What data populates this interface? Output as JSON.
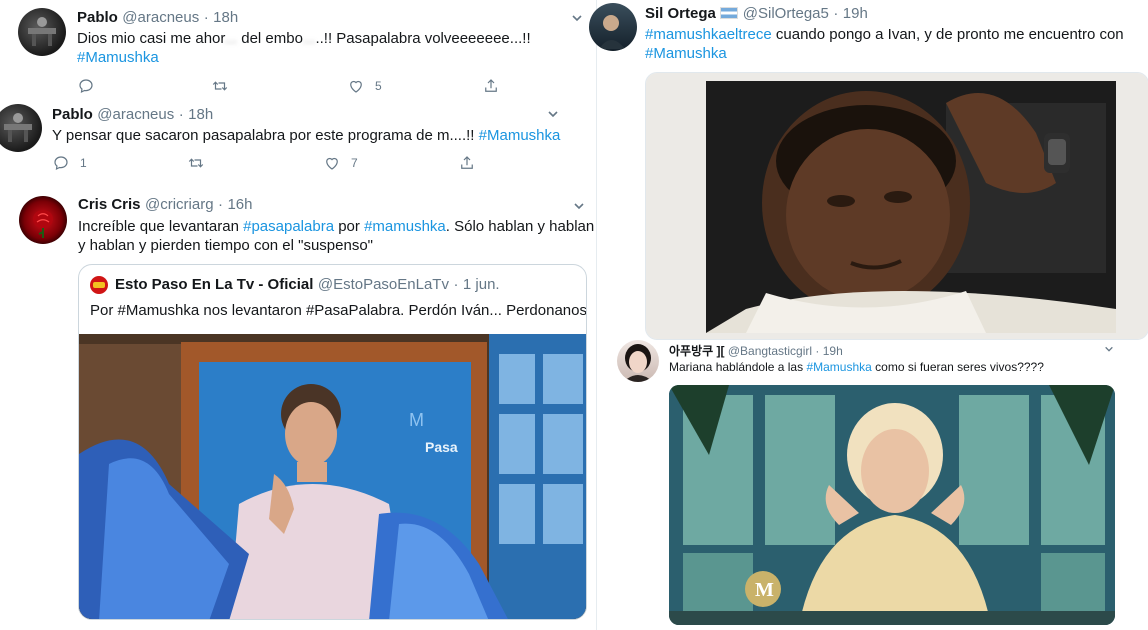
{
  "tweets": [
    {
      "name": "Pablo",
      "handle": "@aracneus",
      "time": "18h",
      "text_pre": "Dios mio casi me ahor",
      "text_blur": "...",
      "text_mid": " del embo",
      "text_blur2": "...",
      "text_post": "..!! Pasapalabra volveeeeeee...!!",
      "hashtag": "#Mamushka",
      "reply_count": "",
      "retweet_count": "",
      "like_count": "5"
    },
    {
      "name": "Pablo",
      "handle": "@aracneus",
      "time": "18h",
      "text": "Y pensar que sacaron pasapalabra por este programa de m....!! ",
      "hashtag": "#Mamushka",
      "reply_count": "1",
      "retweet_count": "",
      "like_count": "7"
    },
    {
      "name": "Cris Cris",
      "handle": "@cricriarg",
      "time": "16h",
      "line1_a": "Increíble que levantaran ",
      "line1_h1": "#pasapalabra",
      "line1_b": " por ",
      "line1_h2": "#mamushka",
      "line1_c": ". Sólo hablan y hablan",
      "line2": "y hablan y pierden tiempo con el \"suspenso\"",
      "quote": {
        "name": "Esto Paso En La Tv - Oficial",
        "handle": "@EstoPasoEnLaTv",
        "date": "1 jun.",
        "text": "Por #Mamushka nos levantaron #PasaPalabra. Perdón Iván... Perdonanos",
        "screen_text_a": "M",
        "screen_text_b": "Pasa"
      }
    }
  ],
  "right": {
    "tweet1": {
      "name": "Sil Ortega",
      "handle": "@SilOrtega5",
      "time": "19h",
      "hashtag": "#mamushkaeltrece",
      "text": " cuando pongo a Ivan, y de pronto me encuentro con",
      "hashtag2": "#Mamushka"
    },
    "tweet2": {
      "name": "아푸방쿠 ][",
      "handle": "@Bangtasticgirl",
      "time": "19h",
      "text_a": "Mariana hablándole a las ",
      "hashtag": "#Mamushka",
      "text_b": " como si fueran seres vivos????",
      "logo_text": "M"
    }
  },
  "colors": {
    "link": "#1b95e0",
    "secondary": "#657786",
    "border": "#e6ecf0"
  }
}
